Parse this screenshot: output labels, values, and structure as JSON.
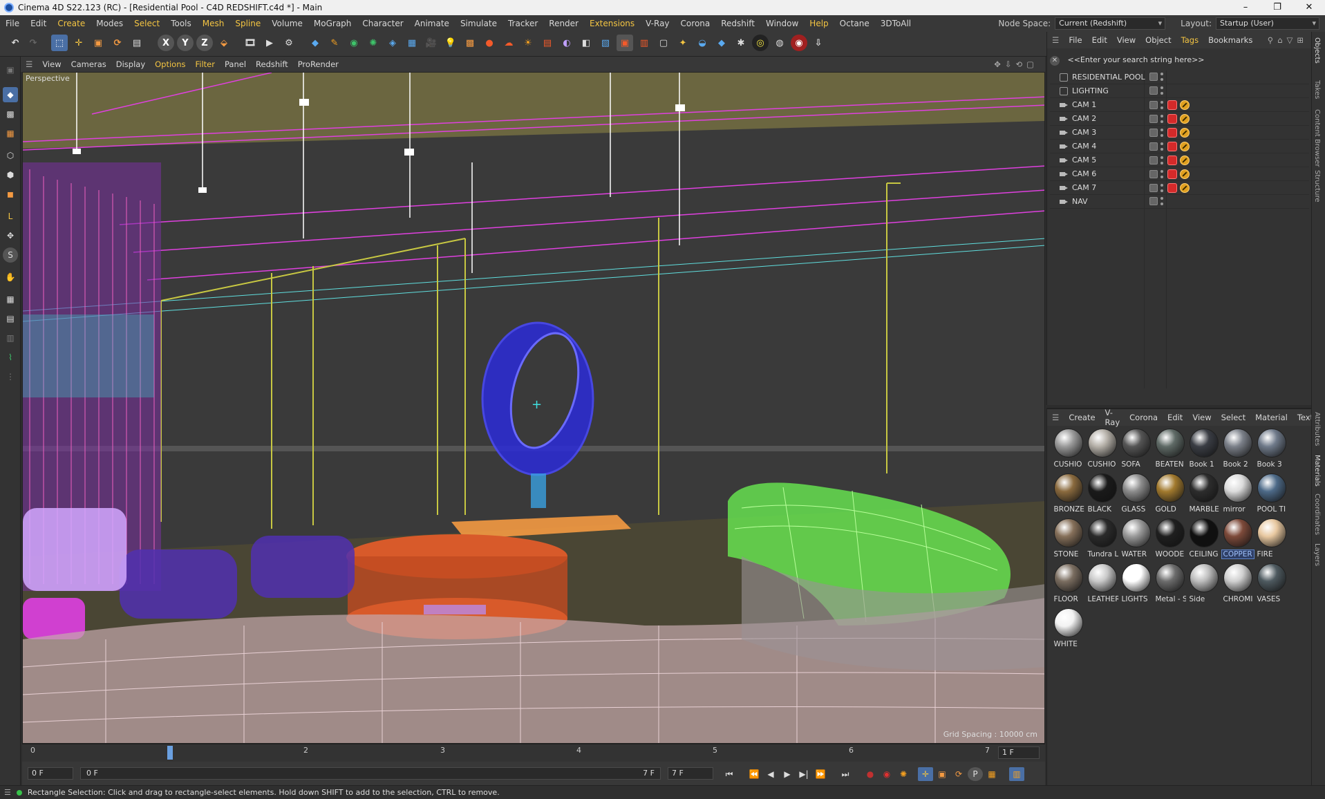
{
  "window": {
    "title": "Cinema 4D S22.123 (RC) - [Residential Pool - C4D REDSHIFT.c4d *] - Main",
    "controls": [
      "–",
      "❐",
      "✕"
    ]
  },
  "menubar": {
    "items": [
      "File",
      "Edit",
      "Create",
      "Modes",
      "Select",
      "Tools",
      "Mesh",
      "Spline",
      "Volume",
      "MoGraph",
      "Character",
      "Animate",
      "Simulate",
      "Tracker",
      "Render",
      "Extensions",
      "V-Ray",
      "Corona",
      "Redshift",
      "Window",
      "Help",
      "Octane",
      "3DToAll"
    ],
    "node_space_label": "Node Space:",
    "node_space_value": "Current (Redshift)",
    "layout_label": "Layout:",
    "layout_value": "Startup (User)"
  },
  "viewport_menu": {
    "items": [
      "View",
      "Cameras",
      "Display",
      "Options",
      "Filter",
      "Panel",
      "Redshift",
      "ProRender"
    ]
  },
  "viewport": {
    "label": "Perspective",
    "grid_spacing": "Grid Spacing : 10000 cm"
  },
  "timeline": {
    "ticks": [
      "0",
      "1",
      "2",
      "3",
      "4",
      "5",
      "6",
      "7"
    ],
    "current_frame_field": "1 F"
  },
  "transport": {
    "start_field": "0 F",
    "range_start": "0 F",
    "range_end": "7 F",
    "end_field": "7 F"
  },
  "statusbar": {
    "text": "Rectangle Selection: Click and drag to rectangle-select elements. Hold down SHIFT to add to the selection, CTRL to remove."
  },
  "object_manager": {
    "menu": [
      "File",
      "Edit",
      "View",
      "Object",
      "Tags",
      "Bookmarks"
    ],
    "search_placeholder": "<<Enter your search string here>>",
    "objects": [
      {
        "name": "RESIDENTIAL POOL",
        "type": "null",
        "tags": []
      },
      {
        "name": "LIGHTING",
        "type": "null",
        "tags": []
      },
      {
        "name": "CAM 1",
        "type": "camera",
        "tags": [
          "redshift",
          "protection"
        ]
      },
      {
        "name": "CAM 2",
        "type": "camera",
        "tags": [
          "redshift",
          "protection"
        ]
      },
      {
        "name": "CAM 3",
        "type": "camera",
        "tags": [
          "redshift",
          "protection"
        ]
      },
      {
        "name": "CAM 4",
        "type": "camera",
        "tags": [
          "redshift",
          "protection"
        ]
      },
      {
        "name": "CAM 5",
        "type": "camera",
        "tags": [
          "redshift",
          "protection"
        ]
      },
      {
        "name": "CAM 6",
        "type": "camera",
        "tags": [
          "redshift",
          "protection"
        ]
      },
      {
        "name": "CAM 7",
        "type": "camera",
        "tags": [
          "redshift",
          "protection"
        ]
      },
      {
        "name": "NAV",
        "type": "camera",
        "tags": []
      }
    ]
  },
  "side_tabs": [
    "Objects",
    "Takes",
    "Content Browser",
    "Structure",
    "Attributes",
    "Materials",
    "Coordinates",
    "Layers"
  ],
  "material_manager": {
    "menu": [
      "Create",
      "V-Ray",
      "Corona",
      "Edit",
      "View",
      "Select",
      "Material",
      "Textu"
    ],
    "materials": [
      {
        "name": "CUSHIO",
        "color": "#9a9a9a"
      },
      {
        "name": "CUSHIO",
        "color": "#b5b0a8"
      },
      {
        "name": "SOFA",
        "color": "#555555"
      },
      {
        "name": "BEATEN",
        "color": "#5f6a66"
      },
      {
        "name": "Book 1",
        "color": "#3a3d44"
      },
      {
        "name": "Book 2",
        "color": "#7b8089"
      },
      {
        "name": "Book 3",
        "color": "#6f7a8a"
      },
      {
        "name": "BRONZE",
        "color": "#8a6a3e"
      },
      {
        "name": "BLACK",
        "color": "#1a1a1a"
      },
      {
        "name": "GLASS",
        "color": "#8c8c8c"
      },
      {
        "name": "GOLD",
        "color": "#a27a2e"
      },
      {
        "name": "MARBLE",
        "color": "#2d2d2d"
      },
      {
        "name": "mirror",
        "color": "#dcdcdc"
      },
      {
        "name": "POOL TI",
        "color": "#4d6a88"
      },
      {
        "name": "STONE",
        "color": "#86705a"
      },
      {
        "name": "Tundra L",
        "color": "#2a2a2a"
      },
      {
        "name": "WATER",
        "color": "#9a9a9a"
      },
      {
        "name": "WOODE",
        "color": "#1f1f1f"
      },
      {
        "name": "CEILING",
        "color": "#101010"
      },
      {
        "name": "COPPER",
        "color": "#7d4a3a"
      },
      {
        "name": "FIRE",
        "color": "#e8c8a0"
      },
      {
        "name": "FLOOR",
        "color": "#7a6d60"
      },
      {
        "name": "LEATHER",
        "color": "#c9c9c9"
      },
      {
        "name": "LIGHTS",
        "color": "#ffffff"
      },
      {
        "name": "Metal - S",
        "color": "#6c6c6c"
      },
      {
        "name": "Side",
        "color": "#bdbdbd"
      },
      {
        "name": "CHROMI",
        "color": "#d0d0d0"
      },
      {
        "name": "VASES",
        "color": "#4e5a60"
      },
      {
        "name": "WHITE",
        "color": "#f2f2f2"
      }
    ],
    "selected": "COPPER"
  },
  "colors": {
    "accent_yellow": "#f4c542",
    "redshift_red": "#d42a2a",
    "selection_blue": "#2f3f66"
  }
}
